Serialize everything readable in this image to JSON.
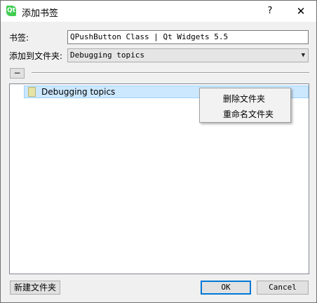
{
  "window": {
    "title": "添加书签",
    "icon_label": "Qt",
    "help_label": "?",
    "close_label": "✕"
  },
  "form": {
    "bookmark_label": "书签:",
    "bookmark_value": "QPushButton Class | Qt Widgets 5.5",
    "folder_label": "添加到文件夹:",
    "folder_value": "Debugging topics"
  },
  "collapse_button": {
    "label": "−"
  },
  "tree": {
    "items": [
      {
        "label": "Debugging topics",
        "icon": "folder-icon",
        "selected": true
      }
    ]
  },
  "context_menu": {
    "items": [
      {
        "label": "删除文件夹"
      },
      {
        "label": "重命名文件夹"
      }
    ]
  },
  "buttons": {
    "new_folder": "新建文件夹",
    "ok": "OK",
    "cancel": "Cancel"
  },
  "colors": {
    "selection_bg": "#cce8ff",
    "default_button_border": "#0078d7",
    "qt_icon": "#41cd52"
  }
}
